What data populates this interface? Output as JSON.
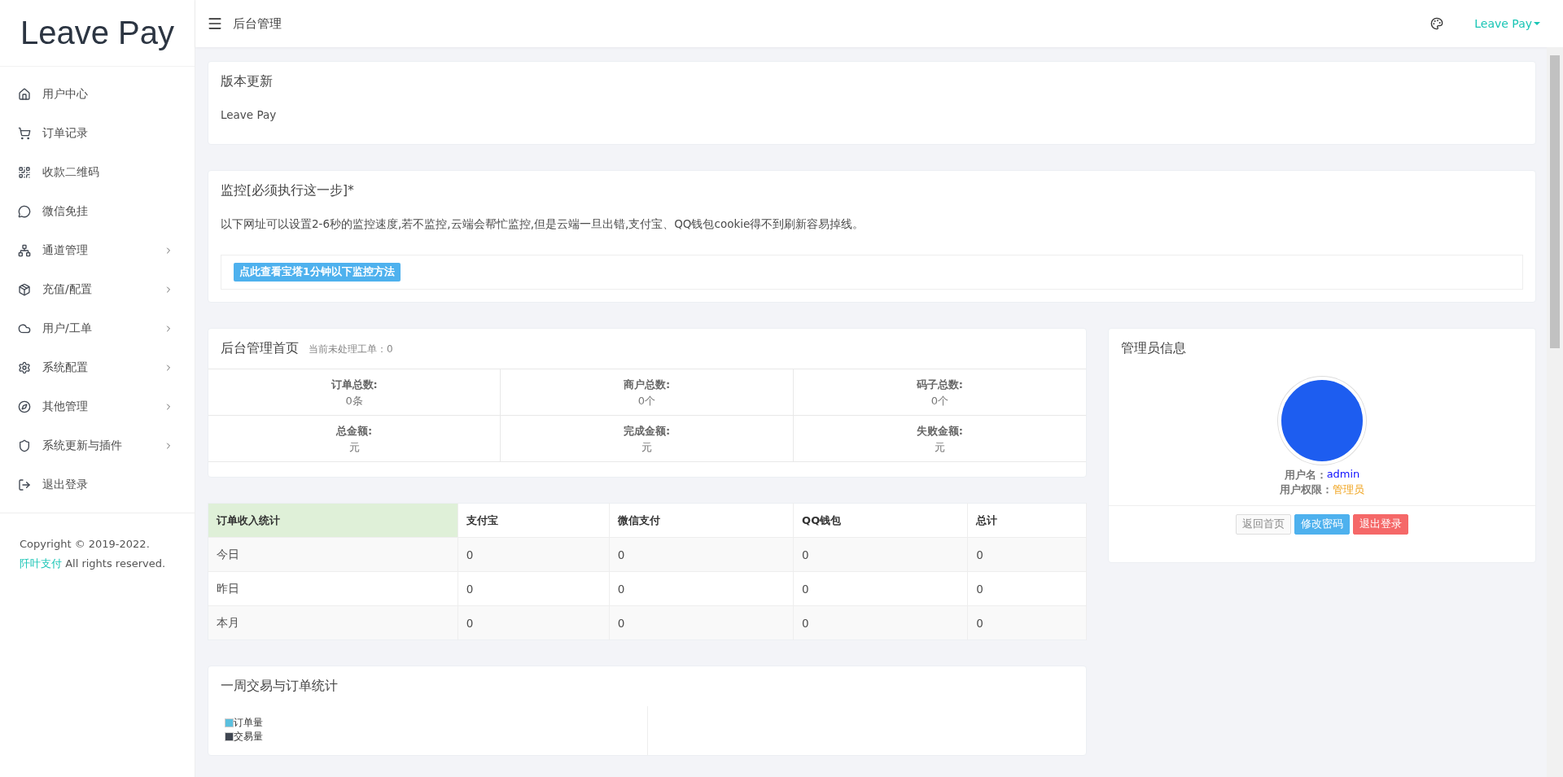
{
  "sidebar": {
    "logo": "Leave Pay",
    "items": [
      {
        "label": "用户中心",
        "has_submenu": false
      },
      {
        "label": "订单记录",
        "has_submenu": false
      },
      {
        "label": "收款二维码",
        "has_submenu": false
      },
      {
        "label": "微信免挂",
        "has_submenu": false
      },
      {
        "label": "通道管理",
        "has_submenu": true
      },
      {
        "label": "充值/配置",
        "has_submenu": true
      },
      {
        "label": "用户/工单",
        "has_submenu": true
      },
      {
        "label": "系统配置",
        "has_submenu": true
      },
      {
        "label": "其他管理",
        "has_submenu": true
      },
      {
        "label": "系统更新与插件",
        "has_submenu": true
      },
      {
        "label": "退出登录",
        "has_submenu": false
      }
    ],
    "copyright": {
      "before": "Copyright © 2019-2022.",
      "link": "阡叶支付",
      "after": "All rights reserved."
    }
  },
  "header": {
    "title": "后台管理",
    "user": "Leave Pay"
  },
  "version_card": {
    "title": "版本更新",
    "body": "Leave Pay"
  },
  "monitor_card": {
    "title": "监控[必须执行这一步]*",
    "body": "以下网址可以设置2-6秒的监控速度,若不监控,云端会帮忙监控,但是云端一旦出错,支付宝、QQ钱包cookie得不到刷新容易掉线。",
    "button": "点此查看宝塔1分钟以下监控方法"
  },
  "stats_card": {
    "title": "后台管理首页",
    "subtitle": "当前未处理工单：0",
    "cells": [
      {
        "label": "订单总数:",
        "value": "0条"
      },
      {
        "label": "商户总数:",
        "value": "0个"
      },
      {
        "label": "码子总数:",
        "value": "0个"
      },
      {
        "label": "总金额:",
        "value": "元"
      },
      {
        "label": "完成金额:",
        "value": "元"
      },
      {
        "label": "失败金额:",
        "value": "元"
      }
    ]
  },
  "income_table": {
    "columns": [
      "订单收入统计",
      "支付宝",
      "微信支付",
      "QQ钱包",
      "总计"
    ],
    "rows": [
      [
        "今日",
        "0",
        "0",
        "0",
        "0"
      ],
      [
        "昨日",
        "0",
        "0",
        "0",
        "0"
      ],
      [
        "本月",
        "0",
        "0",
        "0",
        "0"
      ]
    ]
  },
  "chart_card": {
    "title": "一周交易与订单统计",
    "legend": [
      {
        "label": "订单量",
        "color": "#5bc0de"
      },
      {
        "label": "交易量",
        "color": "#3f4651"
      }
    ]
  },
  "admin_card": {
    "title": "管理员信息",
    "username_label": "用户名：",
    "username": "admin",
    "role_label": "用户权限：",
    "role": "管理员",
    "buttons": [
      {
        "label": "返回首页",
        "kind": "default"
      },
      {
        "label": "修改密码",
        "kind": "primary"
      },
      {
        "label": "退出登录",
        "kind": "danger"
      }
    ]
  }
}
